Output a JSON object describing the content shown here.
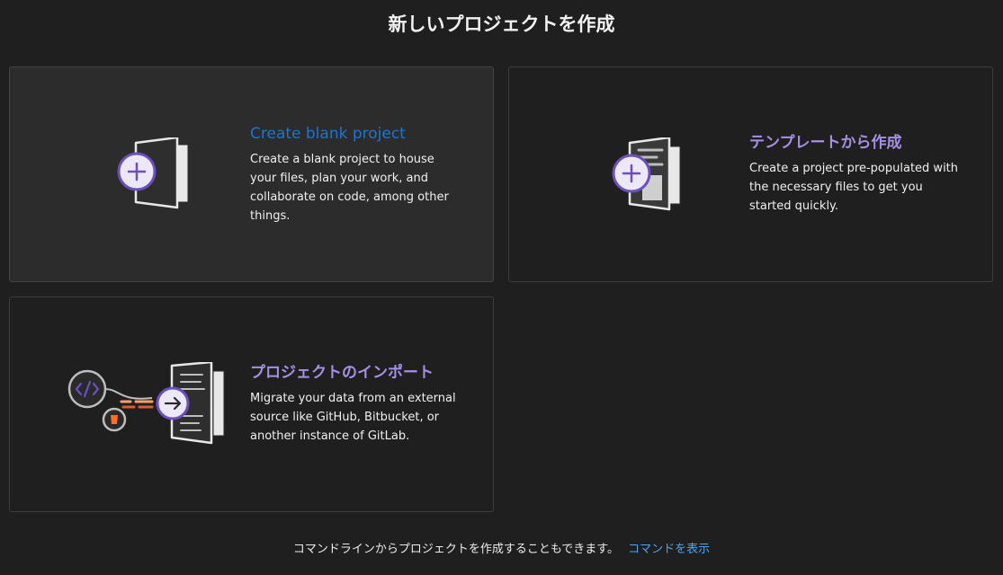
{
  "header": {
    "title": "新しいプロジェクトを作成"
  },
  "cards": {
    "blank": {
      "title": "Create blank project",
      "description": "Create a blank project to house your files, plan your work, and collaborate on code, among other things."
    },
    "template": {
      "title": "テンプレートから作成",
      "description": "Create a project pre-populated with the necessary files to get you started quickly."
    },
    "import": {
      "title": "プロジェクトのインポート",
      "description": "Migrate your data from an external source like GitHub, Bitbucket, or another instance of GitLab."
    }
  },
  "footer": {
    "text": "コマンドラインからプロジェクトを作成することもできます。",
    "link": "コマンドを表示"
  },
  "icons": {
    "blank": "new-project-document-icon",
    "template": "template-document-icon",
    "import": "import-document-icon"
  },
  "colors": {
    "accent_blue": "#1f75cb",
    "accent_purple": "#a591e4",
    "link": "#4aa7f4",
    "icon_ring": "#6b4fbb"
  }
}
